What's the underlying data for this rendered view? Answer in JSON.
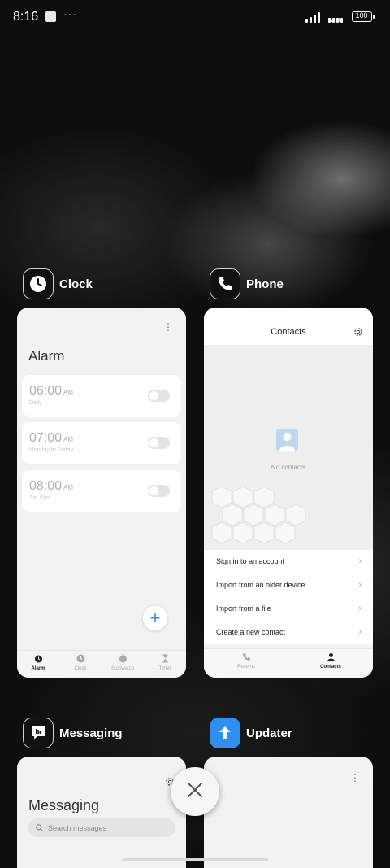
{
  "status_bar": {
    "time": "8:16",
    "overflow": "···",
    "wifi_label": "WIFI",
    "battery": "100"
  },
  "cards": {
    "clock": {
      "app_name": "Clock",
      "icon": "clock-icon",
      "title": "Alarm",
      "alarms": [
        {
          "time": "06:00",
          "ampm": "AM",
          "repeat": "Daily",
          "enabled": false
        },
        {
          "time": "07:00",
          "ampm": "AM",
          "repeat": "Monday to Friday",
          "enabled": false
        },
        {
          "time": "08:00",
          "ampm": "AM",
          "repeat": "Sat Sun",
          "enabled": false
        }
      ],
      "nav": [
        "Alarm",
        "Clock",
        "Stopwatch",
        "Timer"
      ],
      "active_nav": "Alarm"
    },
    "phone": {
      "app_name": "Phone",
      "icon": "phone-icon",
      "title": "Contacts",
      "empty_text": "No contacts",
      "actions": [
        "Sign in to an account",
        "Import from an older device",
        "Import from a file",
        "Create a new contact"
      ],
      "nav": [
        "Recents",
        "Contacts"
      ],
      "active_nav": "Contacts"
    },
    "messaging": {
      "app_name": "Messaging",
      "icon": "message-icon",
      "title": "Messaging",
      "search_placeholder": "Search messages"
    },
    "updater": {
      "app_name": "Updater",
      "icon": "arrow-up-icon"
    }
  },
  "colors": {
    "accent": "#2f8ff0",
    "card_bg": "#f2f2f2",
    "background": "#0d0d0d"
  }
}
